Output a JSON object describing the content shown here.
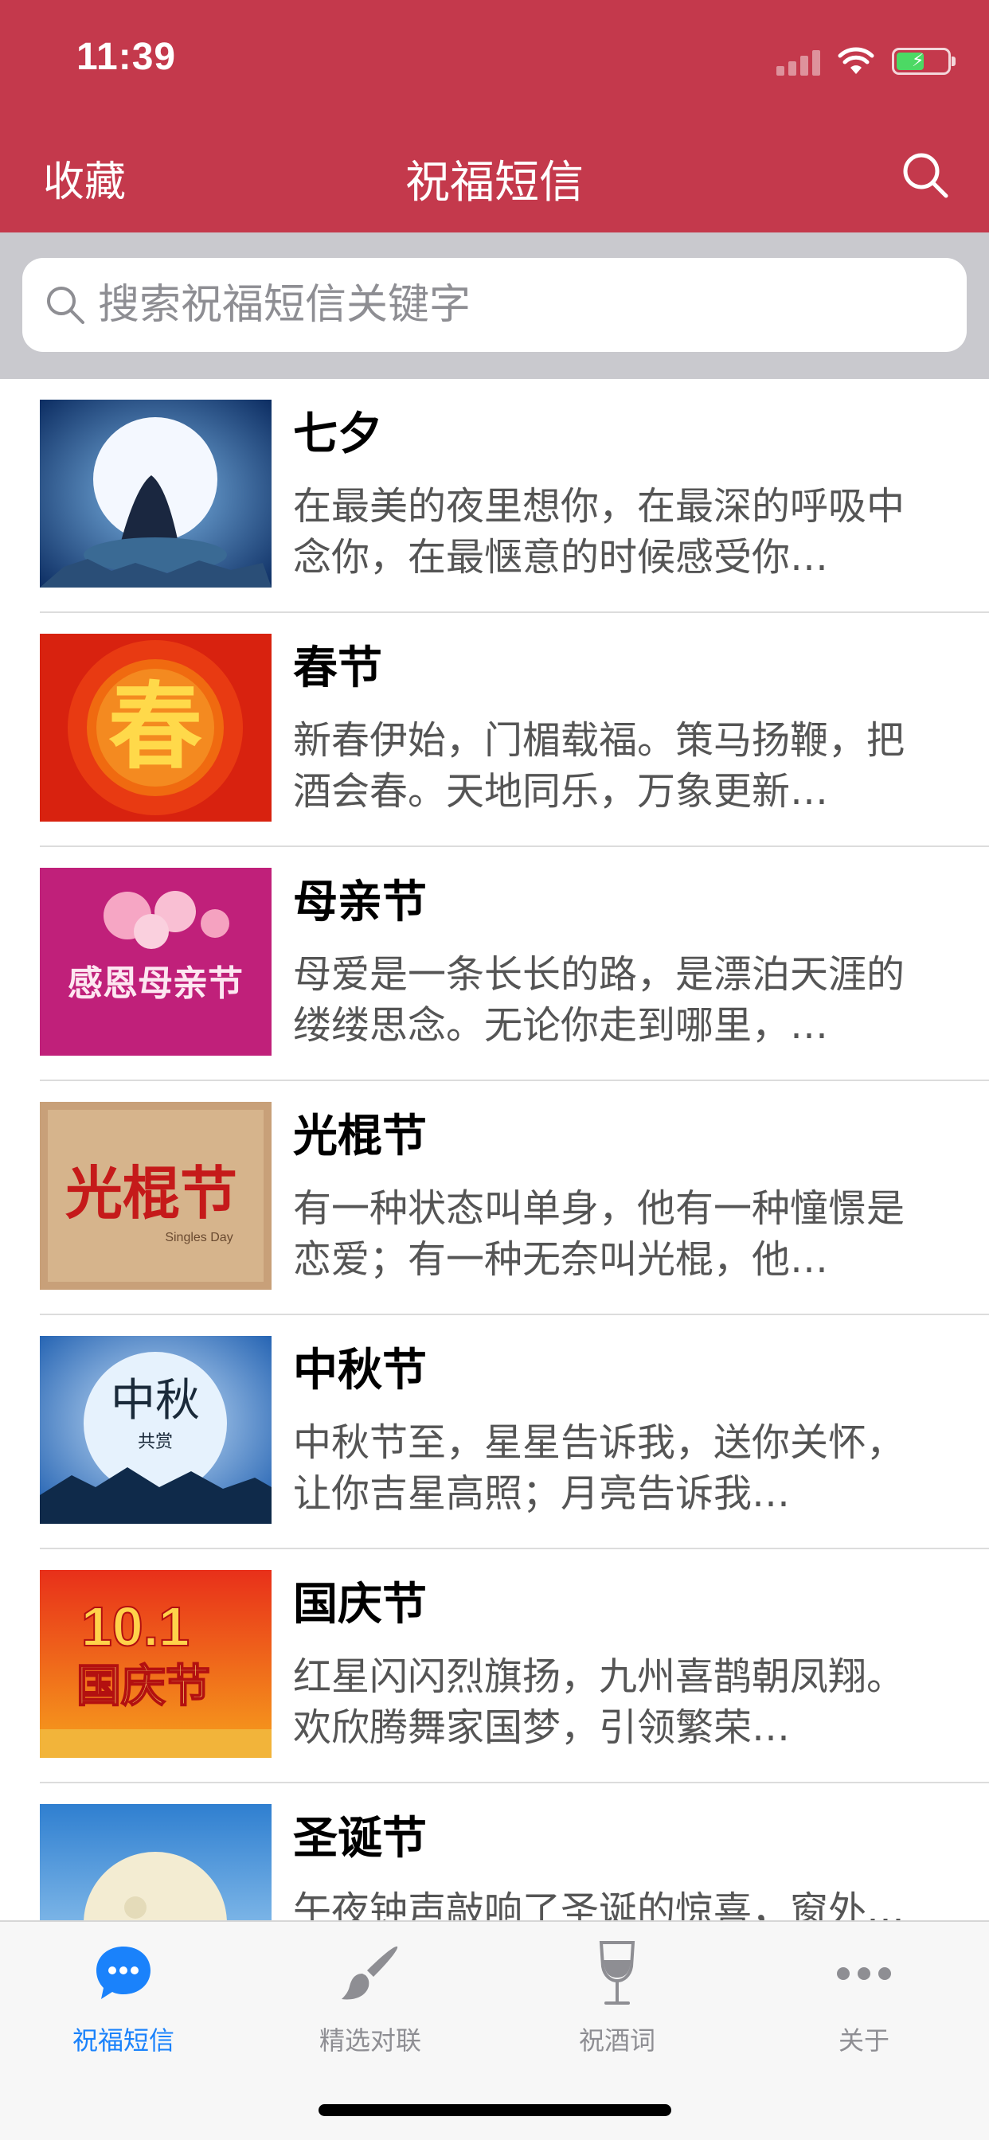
{
  "status_bar": {
    "time": "11:39",
    "battery_percent": 0.5
  },
  "nav": {
    "left_label": "收藏",
    "title": "祝福短信",
    "search_icon": "search-icon"
  },
  "search": {
    "placeholder": "搜索祝福短信关键字",
    "value": ""
  },
  "list": {
    "items": [
      {
        "title": "七夕",
        "desc": "在最美的夜里想你，在最深的呼吸中念你，在最惬意的时候感受你…"
      },
      {
        "title": "春节",
        "desc": "新春伊始，门楣载福。策马扬鞭，把酒会春。天地同乐，万象更新…"
      },
      {
        "title": "母亲节",
        "desc": "母爱是一条长长的路，是漂泊天涯的缕缕思念。无论你走到哪里，…"
      },
      {
        "title": "光棍节",
        "desc": "有一种状态叫单身，他有一种憧憬是恋爱；有一种无奈叫光棍，他…"
      },
      {
        "title": "中秋节",
        "desc": "中秋节至，星星告诉我，送你关怀，让你吉星高照；月亮告诉我…"
      },
      {
        "title": "国庆节",
        "desc": "红星闪闪烈旗扬，九州喜鹊朝凤翔。欢欣腾舞家国梦，引领繁荣…"
      },
      {
        "title": "圣诞节",
        "desc": "午夜钟声敲响了圣诞的惊喜，窗外…"
      }
    ]
  },
  "thumb_text": {
    "spring": "春",
    "mother": "感恩母亲节",
    "singles": "光棍节",
    "singles_sub": "Singles Day",
    "midautumn": "中秋",
    "midautumn_sub": "共赏",
    "national": "10.1",
    "national_sub": "国庆节"
  },
  "tabs": [
    {
      "label": "祝福短信",
      "icon": "chat-bubble-icon",
      "active": true
    },
    {
      "label": "精选对联",
      "icon": "brush-icon",
      "active": false
    },
    {
      "label": "祝酒词",
      "icon": "wine-glass-icon",
      "active": false
    },
    {
      "label": "关于",
      "icon": "more-icon",
      "active": false
    }
  ],
  "colors": {
    "brand": "#c4394c",
    "tab_active": "#1a82fb",
    "tab_inactive": "#8e8e93"
  }
}
